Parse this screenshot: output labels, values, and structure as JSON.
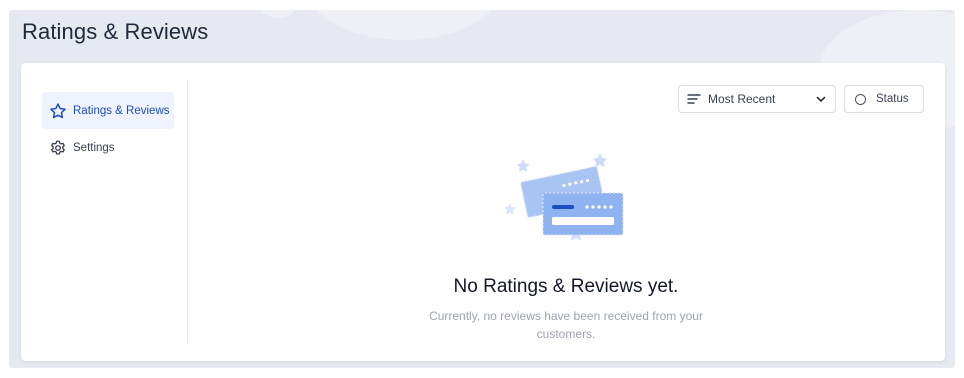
{
  "page": {
    "title": "Ratings & Reviews"
  },
  "sidebar": {
    "items": [
      {
        "label": "Ratings & Reviews",
        "icon": "star-icon",
        "active": true
      },
      {
        "label": "Settings",
        "icon": "gear-icon",
        "active": false
      }
    ]
  },
  "toolbar": {
    "sort": {
      "selected": "Most Recent",
      "icon": "sort-lines-icon"
    },
    "status": {
      "label": "Status",
      "icon": "circle-icon"
    }
  },
  "empty_state": {
    "title": "No Ratings & Reviews yet.",
    "description": "Currently, no reviews have been received from your customers."
  },
  "colors": {
    "accent": "#1d4fbf",
    "active_bg": "#eef3fd",
    "background": "#e6e9ef",
    "card": "#ffffff"
  }
}
